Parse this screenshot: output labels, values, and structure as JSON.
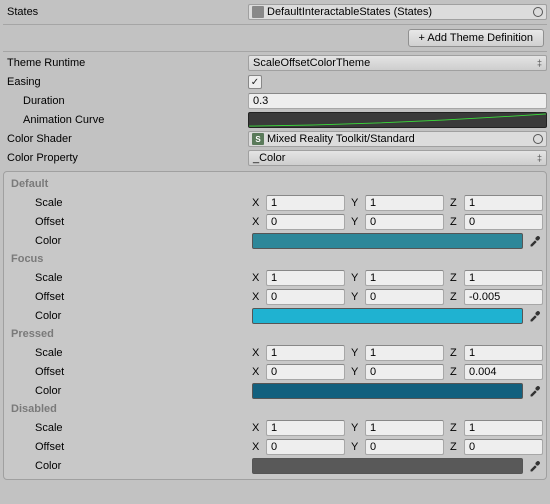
{
  "top": {
    "states_label": "States",
    "states_value": "DefaultInteractableStates (States)",
    "add_theme_btn": "+ Add Theme Definition"
  },
  "runtime": {
    "label": "Theme Runtime",
    "value": "ScaleOffsetColorTheme",
    "easing_label": "Easing",
    "easing_checked": "✓",
    "duration_label": "Duration",
    "duration_value": "0.3",
    "animcurve_label": "Animation Curve",
    "color_shader_label": "Color Shader",
    "color_shader_value": "Mixed Reality Toolkit/Standard",
    "color_prop_label": "Color Property",
    "color_prop_value": "_Color"
  },
  "labels": {
    "scale": "Scale",
    "offset": "Offset",
    "color": "Color",
    "x": "X",
    "y": "Y",
    "z": "Z"
  },
  "states": [
    {
      "name": "Default",
      "scale": {
        "x": "1",
        "y": "1",
        "z": "1"
      },
      "offset": {
        "x": "0",
        "y": "0",
        "z": "0"
      },
      "color": "#2d8799"
    },
    {
      "name": "Focus",
      "scale": {
        "x": "1",
        "y": "1",
        "z": "1"
      },
      "offset": {
        "x": "0",
        "y": "0",
        "z": "-0.005"
      },
      "color": "#1fb2d1"
    },
    {
      "name": "Pressed",
      "scale": {
        "x": "1",
        "y": "1",
        "z": "1"
      },
      "offset": {
        "x": "0",
        "y": "0",
        "z": "0.004"
      },
      "color": "#12607e"
    },
    {
      "name": "Disabled",
      "scale": {
        "x": "1",
        "y": "1",
        "z": "1"
      },
      "offset": {
        "x": "0",
        "y": "0",
        "z": "0"
      },
      "color": "#595959"
    }
  ]
}
